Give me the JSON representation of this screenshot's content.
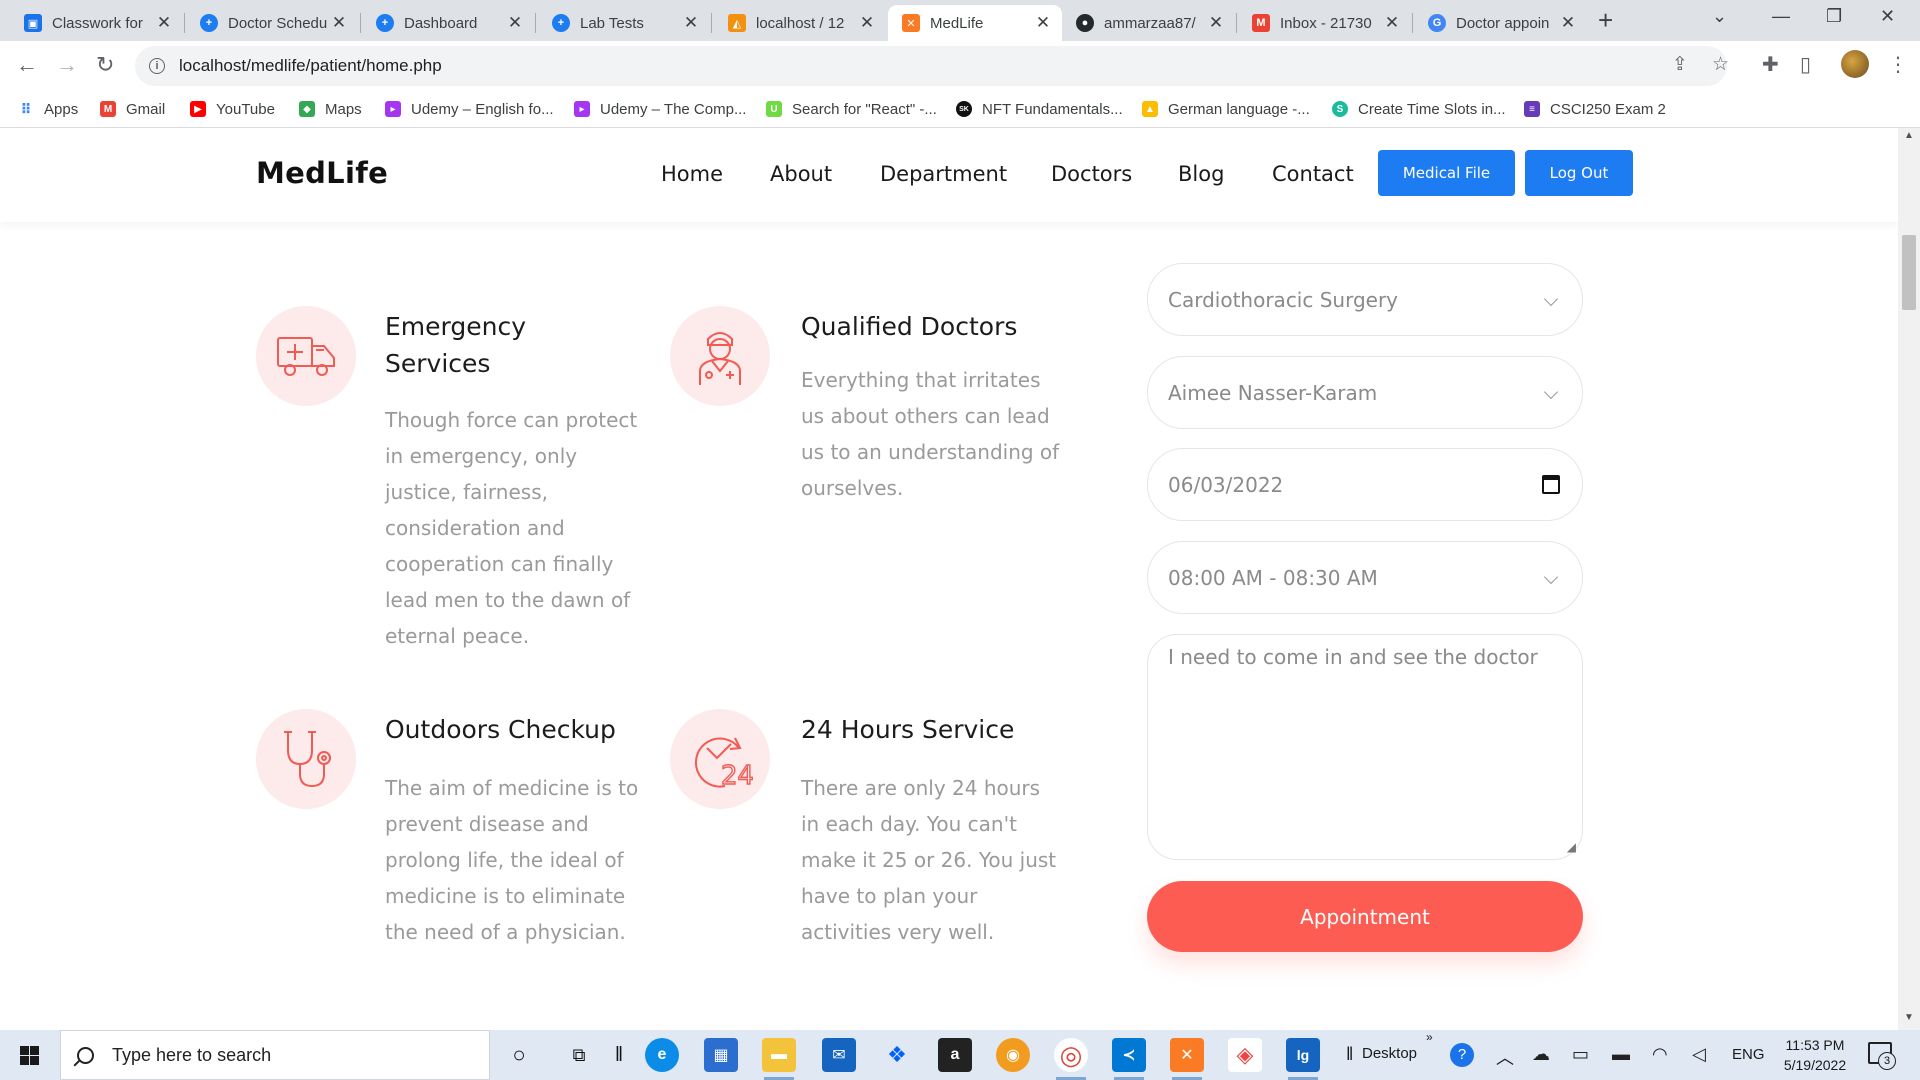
{
  "browser": {
    "tabs": [
      {
        "title": "Classwork for",
        "icon": "classroom-icon",
        "color": "#1a73e8"
      },
      {
        "title": "Doctor Schedu",
        "icon": "medical-cross-icon",
        "color": "#1d7cf2"
      },
      {
        "title": "Dashboard",
        "icon": "medical-cross-icon",
        "color": "#1d7cf2"
      },
      {
        "title": "Lab Tests",
        "icon": "medical-cross-icon",
        "color": "#1d7cf2"
      },
      {
        "title": "localhost / 12",
        "icon": "phpmyadmin-icon",
        "color": "#f29111"
      },
      {
        "title": "MedLife",
        "icon": "xampp-icon",
        "color": "#fb7a24",
        "active": true
      },
      {
        "title": "ammarzaa87/",
        "icon": "github-icon",
        "color": "#24292e"
      },
      {
        "title": "Inbox - 21730",
        "icon": "gmail-icon",
        "color": "#ea4335"
      },
      {
        "title": "Doctor appoin",
        "icon": "google-icon",
        "color": "#4285f4"
      }
    ],
    "url": "localhost/medlife/patient/home.php",
    "bookmarks": [
      {
        "label": "Apps",
        "icon": "apps-grid-icon",
        "color": "#4285f4"
      },
      {
        "label": "Gmail",
        "icon": "gmail-icon",
        "color": "#ea4335"
      },
      {
        "label": "YouTube",
        "icon": "youtube-icon",
        "color": "#ff0000"
      },
      {
        "label": "Maps",
        "icon": "maps-icon",
        "color": "#34a853"
      },
      {
        "label": "Udemy – English fo...",
        "icon": "udemy-icon",
        "color": "#a435f0"
      },
      {
        "label": "Udemy – The Comp...",
        "icon": "udemy-icon",
        "color": "#a435f0"
      },
      {
        "label": "Search for \"React\" -...",
        "icon": "upwork-icon",
        "color": "#6fda44"
      },
      {
        "label": "NFT Fundamentals...",
        "icon": "sk-icon",
        "color": "#111111"
      },
      {
        "label": "German language -...",
        "icon": "drive-icon",
        "color": "#fbbc04"
      },
      {
        "label": "Create Time Slots in...",
        "icon": "stack-icon",
        "color": "#1abc9c"
      },
      {
        "label": "CSCI250 Exam 2",
        "icon": "forms-icon",
        "color": "#673ab7"
      }
    ]
  },
  "site": {
    "logo": "MedLife",
    "menu": [
      "Home",
      "About",
      "Department",
      "Doctors",
      "Blog",
      "Contact"
    ],
    "buttons": {
      "medical_file": "Medical File",
      "logout": "Log Out"
    },
    "accent": "#fd5c52",
    "primary": "#1d7cf2"
  },
  "features": [
    {
      "icon": "ambulance-icon",
      "title": "Emergency Services",
      "text": "Though force can protect in emergency, only justice, fairness, consideration and cooperation can finally lead men to the dawn of eternal peace."
    },
    {
      "icon": "doctor-icon",
      "title": "Qualified Doctors",
      "text": "Everything that irritates us about others can lead us to an understanding of ourselves."
    },
    {
      "icon": "stethoscope-icon",
      "title": "Outdoors Checkup",
      "text": "The aim of medicine is to prevent disease and prolong life, the ideal of medicine is to eliminate the need of a physician."
    },
    {
      "icon": "clock-24-icon",
      "title": "24 Hours Service",
      "text": "There are only 24 hours in each day. You can't make it 25 or 26. You just have to plan your activities very well."
    }
  ],
  "form": {
    "department": "Cardiothoracic Surgery",
    "doctor": "Aimee Nasser-Karam",
    "date": "06/03/2022",
    "time": "08:00 AM - 08:30 AM",
    "message": "I need to come in and see the doctor",
    "submit": "Appointment"
  },
  "taskbar": {
    "search_placeholder": "Type here to search",
    "desktop_label": "Desktop",
    "language": "ENG",
    "time": "11:53 PM",
    "date": "5/19/2022",
    "notifications": "3"
  }
}
